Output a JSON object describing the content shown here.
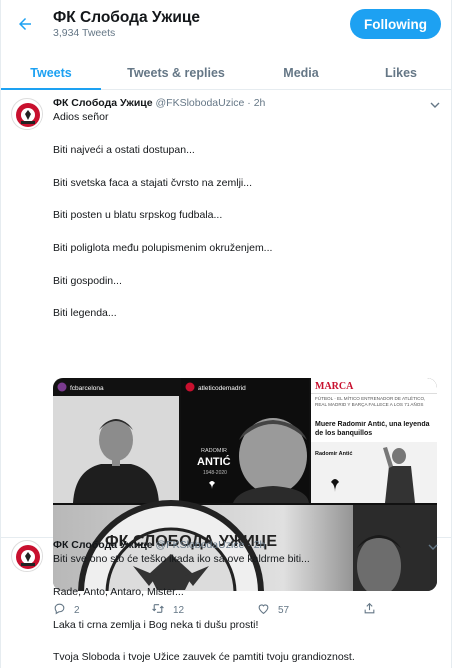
{
  "header": {
    "title": "ФК Слобода Ужице",
    "tweet_count": "3,934 Tweets",
    "follow_label": "Following",
    "accent": "#1da1f2"
  },
  "tabs": [
    "Tweets",
    "Tweets & replies",
    "Media",
    "Likes"
  ],
  "tweets": [
    {
      "name": "ФК Слобода Ужице",
      "handle": "@FKSlobodaUzice · 2h",
      "lines": [
        "Adios señor",
        "Biti najveći a ostati dostupan...",
        "Biti svetska faca a stajati čvrsto na zemlji...",
        "Biti posten u blatu srpskog fudbala...",
        "Biti poliglota među polupismenim okruženjem...",
        "Biti gospodin...",
        "Biti legenda..."
      ],
      "media": {
        "img1_handle": "fcbarcelona",
        "img2_handle": "atleticodemadrid",
        "img2_caption1": "RADOMIR",
        "img2_caption2": "ANTIĆ",
        "img2_years": "1948-2020",
        "img3_brand": "MARCA",
        "img3_kicker": "FÚTBOL · EL MÍTICO ENTRENADOR DE ATLÉTICO, REAL MADRID Y BARÇA FALLECE A LOS 71 AÑOS",
        "img3_headline": "Muere Radomir Antić, una leyenda de los banquillos",
        "img3_signature": "Radomir Antić",
        "crest_text": "ФК СЛОБОДА УЖИЦЕ"
      },
      "replies": "2",
      "retweets": "12",
      "likes": "57"
    },
    {
      "name": "ФК Слобода Ужице",
      "handle": "@FKSlobodaUzice · 2h",
      "lines": [
        "Biti sve ono sto će teško ikada iko sa ove kaldrme biti...",
        "Rade, Anto, Antaro, Mister...",
        "Laka ti crna zemlja i Bog neka ti dušu prosti!",
        "Tvoja Sloboda i tvoje Užice zauvek će pamtiti tvoju grandioznost."
      ]
    }
  ]
}
